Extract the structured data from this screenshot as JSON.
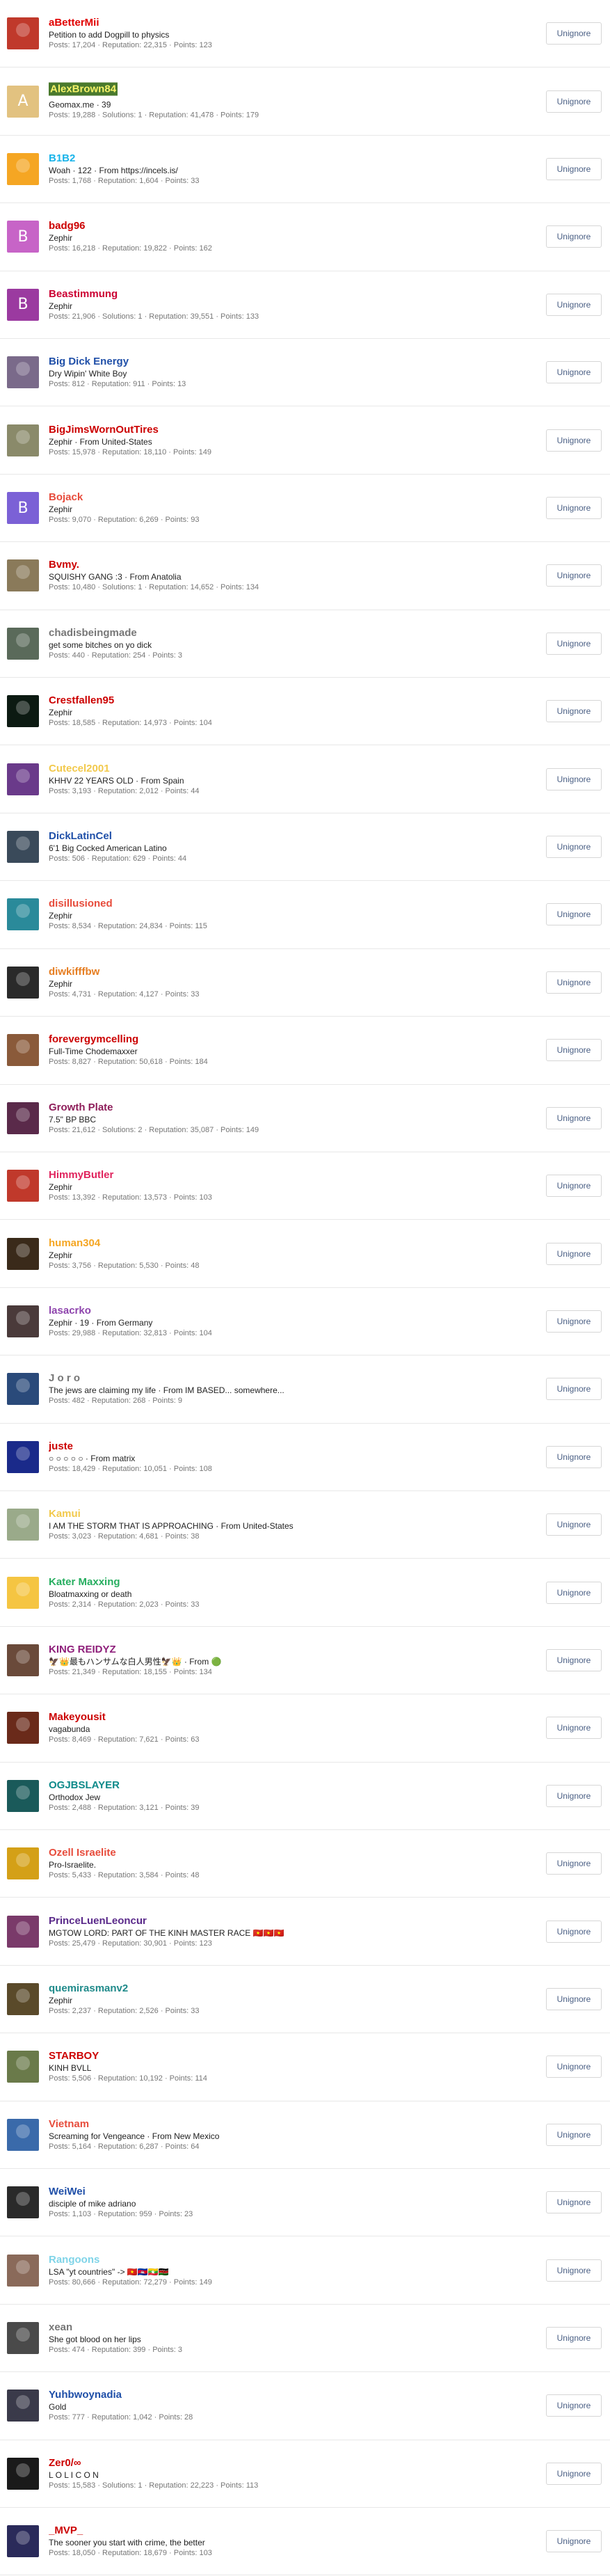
{
  "users": [
    {
      "name": "aBetterMii",
      "color": "#e10000",
      "title": "Petition to add Dogpill to physics",
      "stats": "Posts: 17,204 · Reputation: 22,315 · Points: 123",
      "avatar": "#c0392b",
      "initial": "",
      "name_bg": ""
    },
    {
      "name": "AlexBrown84",
      "color": "#f7f36a",
      "title": "Geomax.me · 39",
      "stats": "Posts: 19,288 · Solutions: 1 · Reputation: 41,478 · Points: 179",
      "avatar": "#e2c280",
      "initial": "A",
      "name_bg": "#4a7a2d"
    },
    {
      "name": "B1B2",
      "color": "#19b4ea",
      "title": "Woah · 122 · From https://incels.is/",
      "stats": "Posts: 1,768 · Reputation: 1,604 · Points: 33",
      "avatar": "#f5a623",
      "initial": "",
      "name_bg": ""
    },
    {
      "name": "badg96",
      "color": "#cc0000",
      "title": "Zephir",
      "stats": "Posts: 16,218 · Reputation: 19,822 · Points: 162",
      "avatar": "#c764c7",
      "initial": "B",
      "name_bg": ""
    },
    {
      "name": "Beastimmung",
      "color": "#cc0033",
      "title": "Zephir",
      "stats": "Posts: 21,906 · Solutions: 1 · Reputation: 39,551 · Points: 133",
      "avatar": "#9b3aa0",
      "initial": "B",
      "name_bg": ""
    },
    {
      "name": "Big Dick Energy",
      "color": "#1f4fa8",
      "title": "Dry Wipin' White Boy",
      "stats": "Posts: 812 · Reputation: 911 · Points: 13",
      "avatar": "#7a6a8a",
      "initial": "",
      "name_bg": ""
    },
    {
      "name": "BigJimsWornOutTires",
      "color": "#cc0000",
      "title": "Zephir · From United-States",
      "stats": "Posts: 15,978 · Reputation: 18,110 · Points: 149",
      "avatar": "#8a8a6a",
      "initial": "",
      "name_bg": ""
    },
    {
      "name": "Bojack",
      "color": "#e74c3c",
      "title": "Zephir",
      "stats": "Posts: 9,070 · Reputation: 6,269 · Points: 93",
      "avatar": "#7b61d6",
      "initial": "B",
      "name_bg": ""
    },
    {
      "name": "Bvmy.",
      "color": "#cc0000",
      "title": "SQUISHY GANG :3 · From Anatolia",
      "stats": "Posts: 10,480 · Solutions: 1 · Reputation: 14,652 · Points: 134",
      "avatar": "#8a7a5a",
      "initial": "",
      "name_bg": ""
    },
    {
      "name": "chadisbeingmade",
      "color": "#777777",
      "title": "get some bitches on yo dick",
      "stats": "Posts: 440 · Reputation: 254 · Points: 3",
      "avatar": "#5a6a5a",
      "initial": "",
      "name_bg": ""
    },
    {
      "name": "Crestfallen95",
      "color": "#cc0000",
      "title": "Zephir",
      "stats": "Posts: 18,585 · Reputation: 14,973 · Points: 104",
      "avatar": "#0c1a12",
      "initial": "",
      "name_bg": ""
    },
    {
      "name": "Cutecel2001",
      "color": "#f2c94c",
      "title": "KHHV 22 YEARS OLD · From Spain",
      "stats": "Posts: 3,193 · Reputation: 2,012 · Points: 44",
      "avatar": "#6a3a8a",
      "initial": "",
      "name_bg": ""
    },
    {
      "name": "DickLatinCel",
      "color": "#1f4fa8",
      "title": "6'1 Big Cocked American Latino",
      "stats": "Posts: 506 · Reputation: 629 · Points: 44",
      "avatar": "#3a4a5a",
      "initial": "",
      "name_bg": ""
    },
    {
      "name": "disillusioned",
      "color": "#e74c3c",
      "title": "Zephir",
      "stats": "Posts: 8,534 · Reputation: 24,834 · Points: 115",
      "avatar": "#2a8a9a",
      "initial": "",
      "name_bg": ""
    },
    {
      "name": "diwkifffbw",
      "color": "#e67e22",
      "title": "Zephir",
      "stats": "Posts: 4,731 · Reputation: 4,127 · Points: 33",
      "avatar": "#2a2a2a",
      "initial": "",
      "name_bg": ""
    },
    {
      "name": "forevergymcelling",
      "color": "#cc0000",
      "title": "Full-Time Chodemaxxer",
      "stats": "Posts: 8,827 · Reputation: 50,618 · Points: 184",
      "avatar": "#8a5a3a",
      "initial": "",
      "name_bg": ""
    },
    {
      "name": "Growth Plate",
      "color": "#8e1e5a",
      "title": "7.5\" BP BBC",
      "stats": "Posts: 21,612 · Solutions: 2 · Reputation: 35,087 · Points: 149",
      "avatar": "#5a2a4a",
      "initial": "",
      "name_bg": ""
    },
    {
      "name": "HimmyButler",
      "color": "#e0245e",
      "title": "Zephir",
      "stats": "Posts: 13,392 · Reputation: 13,573 · Points: 103",
      "avatar": "#c0392b",
      "initial": "",
      "name_bg": ""
    },
    {
      "name": "human304",
      "color": "#f5a623",
      "title": "Zephir",
      "stats": "Posts: 3,756 · Reputation: 5,530 · Points: 48",
      "avatar": "#3a2a1a",
      "initial": "",
      "name_bg": ""
    },
    {
      "name": "lasacrko",
      "color": "#8e44ad",
      "title": "Zephir · 19 · From Germany",
      "stats": "Posts: 29,988 · Reputation: 32,813 · Points: 104",
      "avatar": "#4a3a3a",
      "initial": "",
      "name_bg": ""
    },
    {
      "name": "J o r o",
      "color": "#777777",
      "title": "The jews are claiming my life · From IM BASED... somewhere...",
      "stats": "Posts: 482 · Reputation: 268 · Points: 9",
      "avatar": "#2a4a7a",
      "initial": "",
      "name_bg": ""
    },
    {
      "name": "juste",
      "color": "#cc0000",
      "title": "○ ○ ○ ○ ○ · From matrix",
      "stats": "Posts: 18,429 · Reputation: 10,051 · Points: 108",
      "avatar": "#1a2a8a",
      "initial": "",
      "name_bg": ""
    },
    {
      "name": "Kamui",
      "color": "#f2c94c",
      "title": "I AM THE STORM THAT IS APPROACHING · From United-States",
      "stats": "Posts: 3,023 · Reputation: 4,681 · Points: 38",
      "avatar": "#9aaa8a",
      "initial": "",
      "name_bg": ""
    },
    {
      "name": "Kater Maxxing",
      "color": "#27ae60",
      "title": "Bloatmaxxing or death",
      "stats": "Posts: 2,314 · Reputation: 2,023 · Points: 33",
      "avatar": "#f5c542",
      "initial": "",
      "name_bg": ""
    },
    {
      "name": "KING REIDYZ",
      "color": "#8e1e7a",
      "title": "🦅👑最もハンサムな白人男性🦅👑 · From 🟢",
      "stats": "Posts: 21,349 · Reputation: 18,155 · Points: 134",
      "avatar": "#6a4a3a",
      "initial": "",
      "name_bg": ""
    },
    {
      "name": "Makeyousit",
      "color": "#cc0000",
      "title": "vagabunda",
      "stats": "Posts: 8,469 · Reputation: 7,621 · Points: 63",
      "avatar": "#6a2a1a",
      "initial": "",
      "name_bg": ""
    },
    {
      "name": "OGJBSLAYER",
      "color": "#0e8a8a",
      "title": "Orthodox Jew",
      "stats": "Posts: 2,488 · Reputation: 3,121 · Points: 39",
      "avatar": "#1a5a5a",
      "initial": "",
      "name_bg": ""
    },
    {
      "name": "Ozell Israelite",
      "color": "#e74c3c",
      "title": "Pro-Israelite.",
      "stats": "Posts: 5,433 · Reputation: 3,584 · Points: 48",
      "avatar": "#d4a017",
      "initial": "",
      "name_bg": ""
    },
    {
      "name": "PrinceLuenLeoncur",
      "color": "#5a2a8a",
      "title": "MGTOW LORD: PART OF THE KINH MASTER RACE 🇻🇳🇻🇳🇻🇳",
      "stats": "Posts: 25,479 · Reputation: 30,901 · Points: 123",
      "avatar": "#7a3a6a",
      "initial": "",
      "name_bg": ""
    },
    {
      "name": "quemirasmanv2",
      "color": "#1f8a8a",
      "title": "Zephir",
      "stats": "Posts: 2,237 · Reputation: 2,526 · Points: 33",
      "avatar": "#5a4a2a",
      "initial": "",
      "name_bg": ""
    },
    {
      "name": "STARBOY",
      "color": "#cc0000",
      "title": "KINH BVLL",
      "stats": "Posts: 5,506 · Reputation: 10,192 · Points: 114",
      "avatar": "#6a7a4a",
      "initial": "",
      "name_bg": ""
    },
    {
      "name": "Vietnam",
      "color": "#e74c3c",
      "title": "Screaming for Vengeance · From New Mexico",
      "stats": "Posts: 5,164 · Reputation: 6,287 · Points: 64",
      "avatar": "#3a6aaa",
      "initial": "",
      "name_bg": ""
    },
    {
      "name": "WeiWei",
      "color": "#1f4fa8",
      "title": "disciple of mike adriano",
      "stats": "Posts: 1,103 · Reputation: 959 · Points: 23",
      "avatar": "#2a2a2a",
      "initial": "",
      "name_bg": ""
    },
    {
      "name": "Rangoons",
      "color": "#7fd4e8",
      "title": "LSA \"yt countries\" -> 🇻🇳🇰🇭🇲🇲🇰🇪",
      "stats": "Posts: 80,666 · Reputation: 72,279 · Points: 149",
      "avatar": "#8a6a5a",
      "initial": "",
      "name_bg": ""
    },
    {
      "name": "xean",
      "color": "#777777",
      "title": "She got blood on her lips",
      "stats": "Posts: 474 · Reputation: 399 · Points: 3",
      "avatar": "#4a4a4a",
      "initial": "",
      "name_bg": ""
    },
    {
      "name": "Yuhbwoynadia",
      "color": "#1f4fa8",
      "title": "Gold",
      "stats": "Posts: 777 · Reputation: 1,042 · Points: 28",
      "avatar": "#3a3a4a",
      "initial": "",
      "name_bg": ""
    },
    {
      "name": "Zer0/∞",
      "color": "#cc0000",
      "title": "L O L I C O N",
      "stats": "Posts: 15,583 · Solutions: 1 · Reputation: 22,223 · Points: 113",
      "avatar": "#1a1a1a",
      "initial": "",
      "name_bg": ""
    },
    {
      "name": "_MVP_",
      "color": "#cc0000",
      "title": "The sooner you start with crime, the better",
      "stats": "Posts: 18,050 · Reputation: 18,679 · Points: 103",
      "avatar": "#2a2a5a",
      "initial": "",
      "name_bg": ""
    }
  ],
  "unignore_label": "Unignore"
}
